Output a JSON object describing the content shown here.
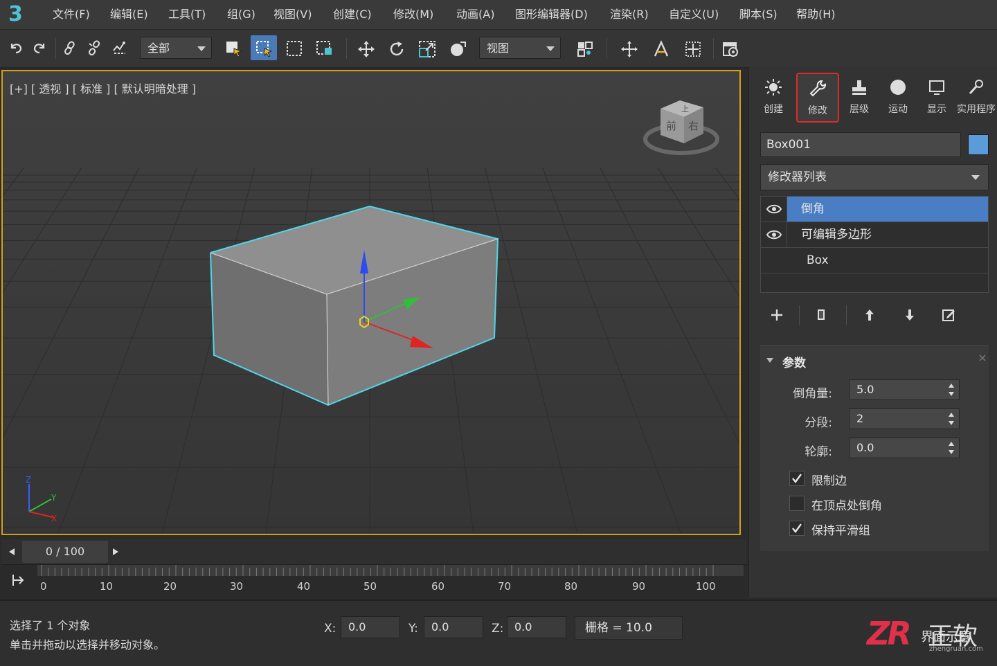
{
  "app": {
    "logo": "3"
  },
  "menu": [
    "文件(F)",
    "编辑(E)",
    "工具(T)",
    "组(G)",
    "视图(V)",
    "创建(C)",
    "修改(M)",
    "动画(A)",
    "图形编辑器(D)",
    "渲染(R)",
    "自定义(U)",
    "脚本(S)",
    "帮助(H)"
  ],
  "toolbar": {
    "selection_filter": "全部",
    "reference_coord": "视图",
    "icons": [
      "undo-icon",
      "redo-icon",
      "link-icon",
      "unlink-icon",
      "bind-spacewarp-icon",
      "select-object-icon",
      "select-by-name-icon",
      "rect-region-icon",
      "window-crossing-icon",
      "move-icon",
      "rotate-icon",
      "scale-icon",
      "place-icon",
      "mirror-icon",
      "pivot-icon",
      "snap-icon",
      "align-icon",
      "render-icon"
    ]
  },
  "viewport": {
    "label": "[+] [ 透视 ] [ 标准 ] [ 默认明暗处理 ]",
    "viewcube": {
      "top": "上",
      "front": "前",
      "right": "右"
    },
    "axis_labels": {
      "x": "X",
      "y": "Y",
      "z": "Z"
    }
  },
  "command_panel": {
    "tabs": [
      {
        "label": "创建",
        "icon": "sun-icon"
      },
      {
        "label": "修改",
        "icon": "wrench-icon",
        "active": true
      },
      {
        "label": "层级",
        "icon": "hierarchy-icon"
      },
      {
        "label": "运动",
        "icon": "motion-icon"
      },
      {
        "label": "显示",
        "icon": "display-icon"
      },
      {
        "label": "实用程序",
        "icon": "utility-icon"
      }
    ],
    "object_name": "Box001",
    "object_color": "#5b9bd9",
    "modifier_list": "修改器列表",
    "stack": [
      "倒角",
      "可编辑多边形",
      "Box"
    ],
    "rollout_title": "参数",
    "params": [
      {
        "label": "倒角量:",
        "value": "5.0"
      },
      {
        "label": "分段:",
        "value": "2"
      },
      {
        "label": "轮廓:",
        "value": "0.0"
      }
    ],
    "checkboxes": [
      {
        "label": "限制边",
        "checked": true
      },
      {
        "label": "在顶点处倒角",
        "checked": false
      },
      {
        "label": "保持平滑组",
        "checked": true
      }
    ]
  },
  "timeline": {
    "frame": "0 / 100",
    "ticks": [
      "0",
      "10",
      "20",
      "30",
      "40",
      "50",
      "60",
      "70",
      "80",
      "90",
      "100"
    ]
  },
  "status": {
    "line1": "选择了 1 个对象",
    "line2": "单击并拖动以选择并移动对象。",
    "x_label": "X:",
    "x": "0.0",
    "y_label": "Y:",
    "y": "0.0",
    "z_label": "Z:",
    "z": "0.0",
    "grid": "栅格 = 10.0"
  },
  "watermark": {
    "brand": "ZR",
    "text": "正软",
    "sub": "zhengruan.com",
    "overlay": "界面示意"
  }
}
